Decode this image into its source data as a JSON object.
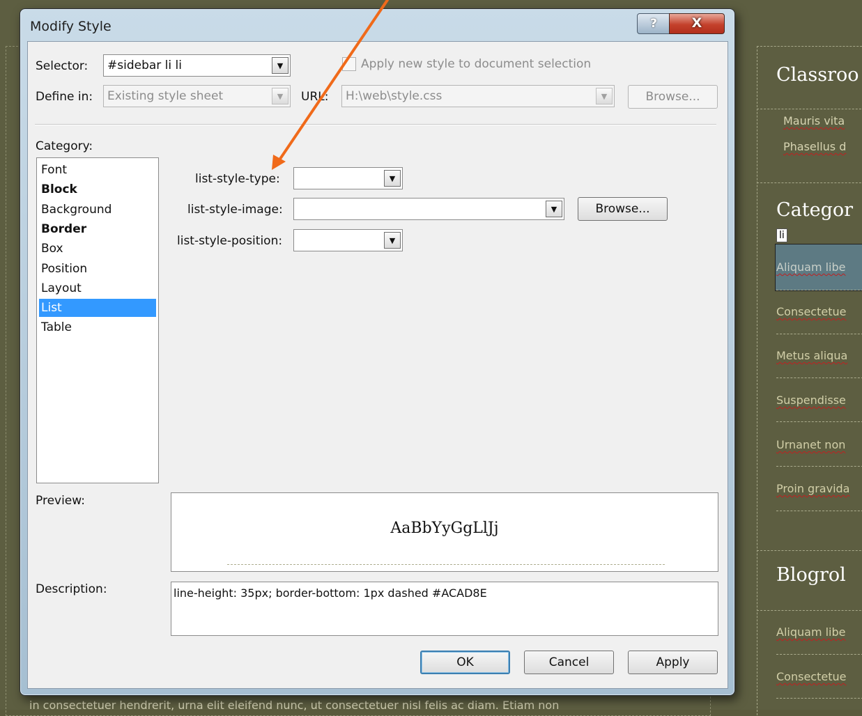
{
  "background": {
    "sidebar": {
      "headings": [
        "Classroo",
        "Categor",
        "Blogrol"
      ],
      "intro_lines": [
        "Mauris  vita",
        "Phasellus d"
      ],
      "category_items": [
        "Aliquam libe",
        "Consectetue",
        "Metus aliqua",
        "Suspendisse",
        "Urnanet non",
        "Proin gravida"
      ],
      "blogroll_items": [
        "Aliquam libe",
        "Consectetue"
      ],
      "element_tag": "li"
    },
    "bottom_text": "in consectetuer hendrerit, urna elit eleifend nunc, ut consectetuer nisl felis ac diam. Etiam non",
    "colors": {
      "page_bg": "#5d5e41",
      "selected_item_bg": "#5d7a83",
      "annotation_arrow": "#f06a1a"
    }
  },
  "dialog": {
    "title": "Modify Style",
    "help_glyph": "?",
    "close_glyph": "X",
    "selector": {
      "label": "Selector:",
      "value": "#sidebar li li"
    },
    "apply_to_selection_label": "Apply new style to document selection",
    "define_in": {
      "label": "Define in:",
      "value": "Existing style sheet"
    },
    "url": {
      "label": "URL:",
      "value": "H:\\web\\style.css"
    },
    "browse_top_label": "Browse...",
    "category": {
      "label": "Category:",
      "items": [
        {
          "label": "Font",
          "bold": false
        },
        {
          "label": "Block",
          "bold": true
        },
        {
          "label": "Background",
          "bold": false
        },
        {
          "label": "Border",
          "bold": true
        },
        {
          "label": "Box",
          "bold": false
        },
        {
          "label": "Position",
          "bold": false
        },
        {
          "label": "Layout",
          "bold": false
        },
        {
          "label": "List",
          "bold": false,
          "selected": true
        },
        {
          "label": "Table",
          "bold": false
        }
      ]
    },
    "list_props": {
      "type_label": "list-style-type:",
      "type_value": "",
      "image_label": "list-style-image:",
      "image_value": "",
      "image_browse_label": "Browse...",
      "position_label": "list-style-position:",
      "position_value": ""
    },
    "preview": {
      "label": "Preview:",
      "sample": "AaBbYyGgLlJj"
    },
    "description": {
      "label": "Description:",
      "text": "line-height: 35px; border-bottom: 1px dashed #ACAD8E"
    },
    "buttons": {
      "ok": "OK",
      "cancel": "Cancel",
      "apply": "Apply"
    }
  }
}
